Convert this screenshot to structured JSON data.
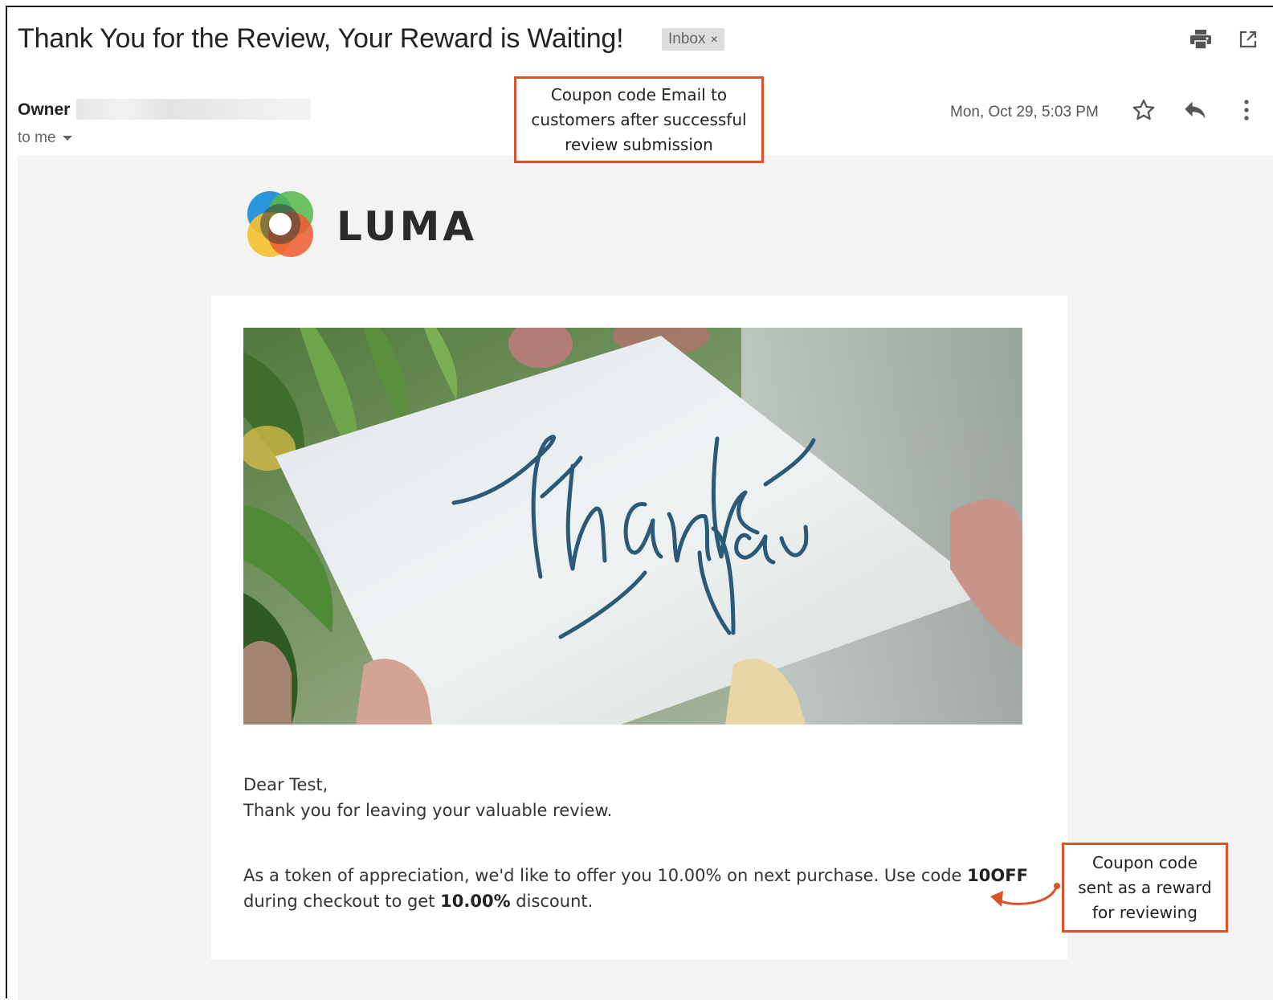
{
  "email": {
    "subject": "Thank You for the Review, Your Reward is Waiting!",
    "label_chip": "Inbox",
    "label_chip_close": "×",
    "sender_name": "Owner",
    "recipient": "to me",
    "date": "Mon, Oct 29, 5:03 PM"
  },
  "icons": {
    "print": "print-icon",
    "open_new_window": "open-in-new-window-icon",
    "star": "star-icon",
    "reply": "reply-icon",
    "more": "more-vertical-icon",
    "recipient_details": "caret-down-icon"
  },
  "brand": {
    "name": "LUMA",
    "logo_colors": [
      "#1f8fd6",
      "#52b848",
      "#f6c12f",
      "#ee5a2f"
    ]
  },
  "message": {
    "hero_handwriting": "Thank you",
    "greeting": "Dear Test,",
    "thanks_line": "Thank you for leaving your valuable review.",
    "offer_prefix": "As a token of appreciation, we'd like to offer you 10.00% on next purchase. Use code ",
    "coupon_code": "10OFF",
    "offer_line2_prefix": "during checkout to get ",
    "discount": "10.00%",
    "offer_line2_suffix": " discount."
  },
  "annotations": {
    "top_callout": [
      "Coupon code Email to",
      "customers after successful",
      "review submission"
    ],
    "bottom_callout": [
      "Coupon code",
      "sent as a reward",
      "for reviewing"
    ],
    "callout_color": "#d9542b"
  }
}
